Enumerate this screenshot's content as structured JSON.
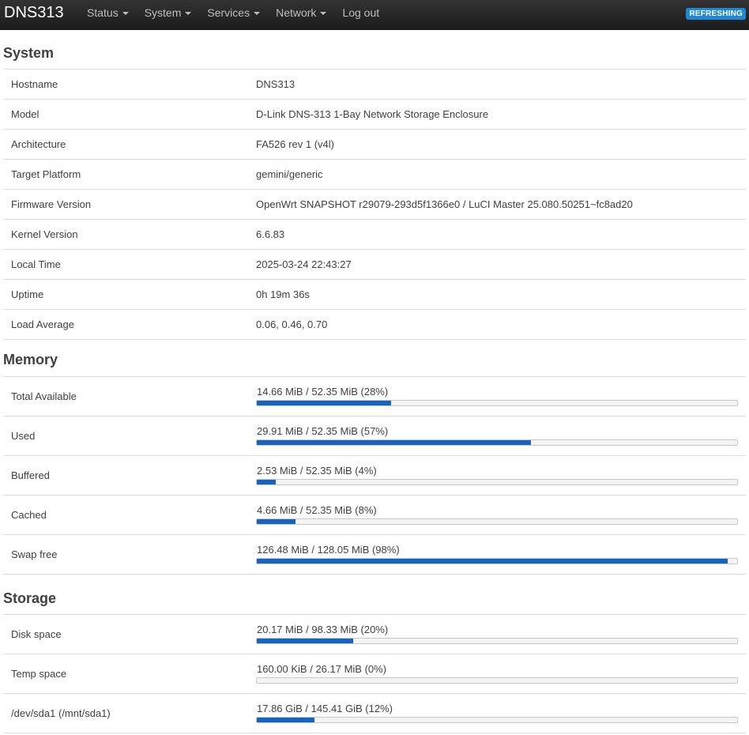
{
  "header": {
    "brand": "DNS313",
    "nav": [
      {
        "label": "Status",
        "dropdown": true
      },
      {
        "label": "System",
        "dropdown": true
      },
      {
        "label": "Services",
        "dropdown": true
      },
      {
        "label": "Network",
        "dropdown": true
      },
      {
        "label": "Log out",
        "dropdown": false
      }
    ],
    "status_badge": "REFRESHING"
  },
  "system": {
    "title": "System",
    "rows": [
      {
        "label": "Hostname",
        "value": "DNS313"
      },
      {
        "label": "Model",
        "value": "D-Link DNS-313 1-Bay Network Storage Enclosure"
      },
      {
        "label": "Architecture",
        "value": "FA526 rev 1 (v4l)"
      },
      {
        "label": "Target Platform",
        "value": "gemini/generic"
      },
      {
        "label": "Firmware Version",
        "value": "OpenWrt SNAPSHOT r29079-293d5f1366e0 / LuCI Master 25.080.50251~fc8ad20"
      },
      {
        "label": "Kernel Version",
        "value": "6.6.83"
      },
      {
        "label": "Local Time",
        "value": "2025-03-24 22:43:27"
      },
      {
        "label": "Uptime",
        "value": "0h 19m 36s"
      },
      {
        "label": "Load Average",
        "value": "0.06, 0.46, 0.70"
      }
    ]
  },
  "memory": {
    "title": "Memory",
    "rows": [
      {
        "label": "Total Available",
        "text": "14.66 MiB / 52.35 MiB (28%)",
        "percent": 28
      },
      {
        "label": "Used",
        "text": "29.91 MiB / 52.35 MiB (57%)",
        "percent": 57
      },
      {
        "label": "Buffered",
        "text": "2.53 MiB / 52.35 MiB (4%)",
        "percent": 4
      },
      {
        "label": "Cached",
        "text": "4.66 MiB / 52.35 MiB (8%)",
        "percent": 8
      },
      {
        "label": "Swap free",
        "text": "126.48 MiB / 128.05 MiB (98%)",
        "percent": 98
      }
    ]
  },
  "storage": {
    "title": "Storage",
    "rows": [
      {
        "label": "Disk space",
        "text": "20.17 MiB / 98.33 MiB (20%)",
        "percent": 20
      },
      {
        "label": "Temp space",
        "text": "160.00 KiB / 26.17 MiB (0%)",
        "percent": 0
      },
      {
        "label": "/dev/sda1 (/mnt/sda1)",
        "text": "17.86 GiB / 145.41 GiB (12%)",
        "percent": 12
      }
    ]
  },
  "colors": {
    "accent": "#1565c0",
    "badge": "#1e88d7",
    "topbar": "#222222"
  }
}
